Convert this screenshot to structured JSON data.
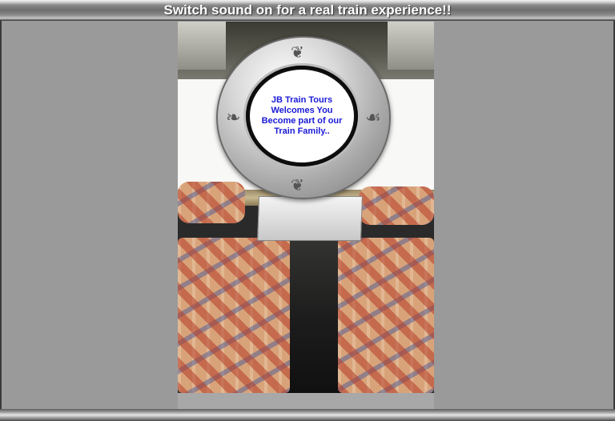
{
  "header": {
    "banner_text": "Switch sound on for a real train experience!!"
  },
  "porthole": {
    "lines": [
      "JB Train Tours",
      "Welcomes You",
      "Become part of our",
      "Train Family.."
    ],
    "text_color": "#1a1ad8"
  },
  "icons": {
    "ornament": "scroll-flourish-icon"
  },
  "colors": {
    "page_background": "#9a9a9a",
    "banner_text": "#ffffff"
  }
}
